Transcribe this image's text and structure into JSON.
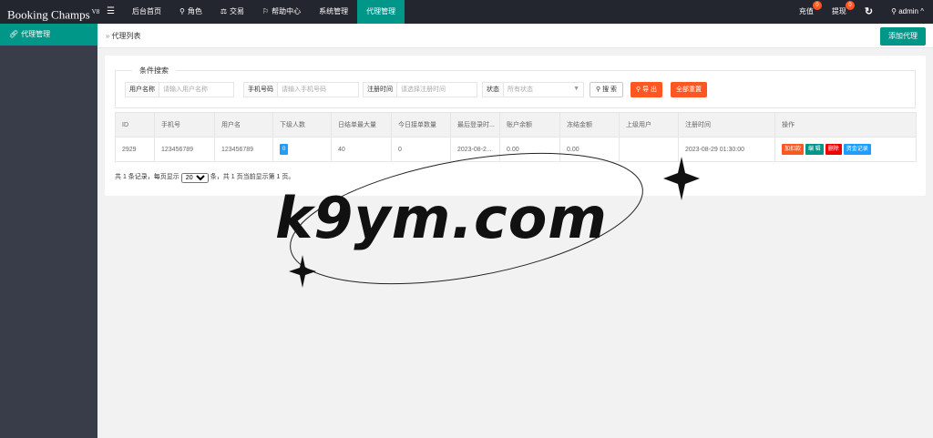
{
  "app": {
    "title": "Booking Champs",
    "version": "V8"
  },
  "topnav": {
    "menu_icon": "menu-icon",
    "items": [
      {
        "label": "后台首页",
        "icon": ""
      },
      {
        "label": "角色",
        "icon": "user-icon"
      },
      {
        "label": "交易",
        "icon": "scale-icon"
      },
      {
        "label": "帮助中心",
        "icon": "flag-icon"
      },
      {
        "label": "系统管理",
        "icon": ""
      },
      {
        "label": "代理管理",
        "icon": "",
        "active": true
      }
    ]
  },
  "topright": {
    "recharge": {
      "label": "充值",
      "badge": "0"
    },
    "withdraw": {
      "label": "提现",
      "badge": "0"
    },
    "user": {
      "label": "admin"
    }
  },
  "sidebar": {
    "items": [
      {
        "label": "代理管理",
        "icon": "link-icon"
      }
    ]
  },
  "breadcrumb": {
    "label": "代理列表"
  },
  "header": {
    "add_button": "添加代理"
  },
  "search": {
    "legend": "条件搜索",
    "username": {
      "label": "用户名称",
      "placeholder": "请输入用户名称"
    },
    "phone": {
      "label": "手机号码",
      "placeholder": "请输入手机号码"
    },
    "regtime": {
      "label": "注册时间",
      "placeholder": "请选择注册时间"
    },
    "status": {
      "label": "状态",
      "value": "所有状态"
    },
    "search_button": "搜 索",
    "export_button": "导 出",
    "reset_button": "全部重置"
  },
  "table": {
    "columns": [
      "ID",
      "手机号",
      "用户名",
      "下级人数",
      "日结单最大量",
      "今日接单数量",
      "最后登录时...",
      "账户余额",
      "冻结金额",
      "上级用户",
      "注册时间",
      "操作"
    ],
    "rows": [
      {
        "id": "2929",
        "phone": "123456789",
        "username": "123456789",
        "sub_count": "0",
        "daily_max": "40",
        "today_orders": "0",
        "last_login": "2023-08-2...",
        "balance": "0.00",
        "frozen": "0.00",
        "parent": "",
        "reg_time": "2023-08-29 01:30:00",
        "actions": [
          "加扣款",
          "编 辑",
          "删除",
          "资金记录"
        ]
      }
    ]
  },
  "pager": {
    "prefix": "共 1 条记录，每页显示",
    "page_size": "20",
    "suffix": "条，共 1 页当前显示第 1 页。"
  },
  "watermark": {
    "text": "k9ym.com"
  },
  "colors": {
    "topbar": "#23262e",
    "sidebar": "#393d49",
    "accent": "#009688",
    "danger": "#ff5722",
    "info": "#1e9fff"
  }
}
